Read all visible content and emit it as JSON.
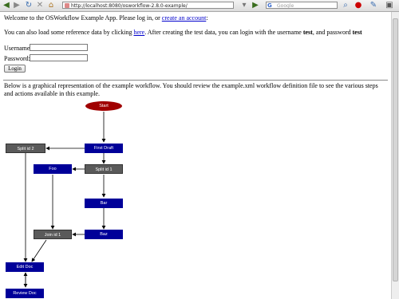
{
  "browser": {
    "url": "http://localhost:8080/osworkflow-2.8.0-example/",
    "search_placeholder": "Google",
    "colors": {
      "toolbar": "#dcdcdc",
      "go": "#3a6d1e"
    }
  },
  "welcome": {
    "line1_prefix": "Welcome to the OSWorkflow Example App. Please log in, or",
    "create_account_link": "create an account",
    "line1_suffix": ":",
    "line2_prefix": "You can also load some reference data by clicking",
    "here_link": "here",
    "line2_middle": ". After creating the test data, you can login with the username",
    "username_value": "test",
    "line2_and": ", and password",
    "password_value": "test"
  },
  "form": {
    "username_label": "Username:",
    "password_label": "Password:",
    "login_button": "Login"
  },
  "description": "Below is a graphical representation of the example workflow. You should review the example.xml workflow definition file to see the various steps and actions available in this example.",
  "workflow": {
    "start": "Start",
    "first_draft": "First Draft",
    "split1": "Split id 1",
    "split2": "Split id 2",
    "foo": "Foo",
    "bar": "Bar",
    "baz": "Baz",
    "join1": "Join id 1",
    "edit_doc": "Edit Doc",
    "review_doc": "Review Doc",
    "colors": {
      "step": "#000099",
      "split": "#5a5a5a",
      "start": "#a00000"
    }
  }
}
